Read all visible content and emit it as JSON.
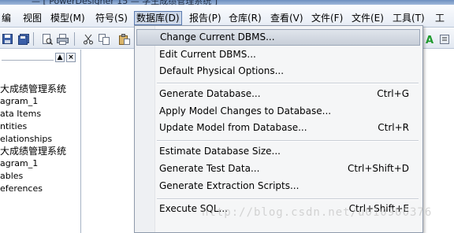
{
  "menubar": {
    "items": [
      {
        "label": "编"
      },
      {
        "label": "视图"
      },
      {
        "label": "模型(M)"
      },
      {
        "label": "符号(S)"
      },
      {
        "label": "数据库(D)"
      },
      {
        "label": "报告(P)"
      },
      {
        "label": "仓库(R)"
      },
      {
        "label": "查看(V)"
      },
      {
        "label": "文件(F)"
      },
      {
        "label": "文件(E)"
      },
      {
        "label": "工具(T)"
      },
      {
        "label": "工"
      }
    ]
  },
  "toolbar": {
    "icons": [
      "save-icon",
      "save-all-icon",
      "print-preview-icon",
      "print-icon",
      "cut-icon",
      "copy-icon",
      "paste-icon",
      "check-model-icon"
    ]
  },
  "browser": {
    "tree": [
      {
        "label": "大成绩管理系统",
        "cn": true
      },
      {
        "label": "agram_1",
        "cn": false
      },
      {
        "label": "ata Items",
        "cn": false
      },
      {
        "label": "ntities",
        "cn": false
      },
      {
        "label": "elationships",
        "cn": false
      },
      {
        "label": "大成绩管理系统",
        "cn": true
      },
      {
        "label": "agram_1",
        "cn": false
      },
      {
        "label": "ables",
        "cn": false
      },
      {
        "label": "eferences",
        "cn": false
      }
    ]
  },
  "dropdown": {
    "items": [
      {
        "label": "Change Current DBMS...",
        "shortcut": "",
        "highlighted": true
      },
      {
        "label": "Edit Current DBMS...",
        "shortcut": "",
        "highlighted": false
      },
      {
        "label": "Default Physical Options...",
        "shortcut": "",
        "highlighted": false
      },
      {
        "label": "Generate Database...",
        "shortcut": "Ctrl+G",
        "highlighted": false
      },
      {
        "label": "Apply Model Changes to Database...",
        "shortcut": "",
        "highlighted": false
      },
      {
        "label": "Update Model from Database...",
        "shortcut": "Ctrl+R",
        "highlighted": false
      },
      {
        "label": "Estimate Database Size...",
        "shortcut": "",
        "highlighted": false
      },
      {
        "label": "Generate Test Data...",
        "shortcut": "Ctrl+Shift+D",
        "highlighted": false
      },
      {
        "label": "Generate Extraction Scripts...",
        "shortcut": "",
        "highlighted": false
      },
      {
        "label": "Execute SQL...",
        "shortcut": "Ctrl+Shift+E",
        "highlighted": false
      }
    ]
  },
  "watermark": "http://blog.csdn.net/u010900376"
}
